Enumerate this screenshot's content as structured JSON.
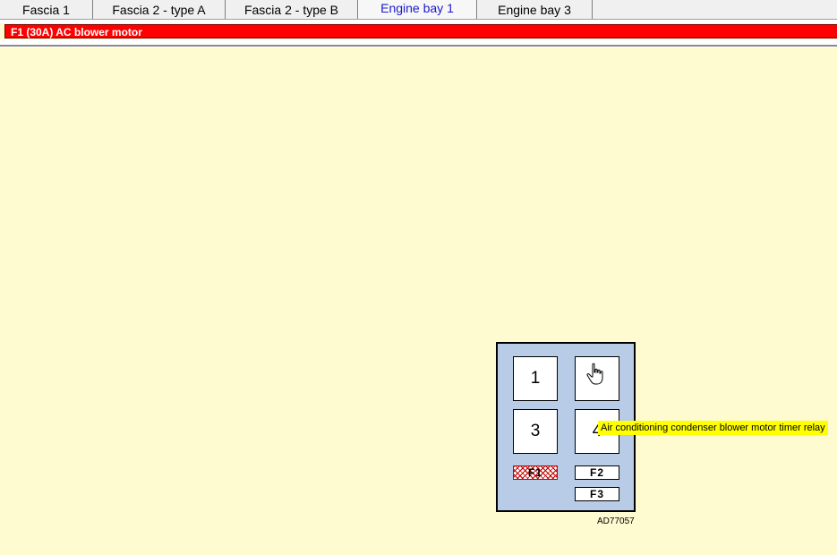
{
  "tabs": [
    {
      "label": "Fascia 1"
    },
    {
      "label": "Fascia 2 - type A"
    },
    {
      "label": "Fascia 2 - type B"
    },
    {
      "label": "Engine bay 1",
      "active": true
    },
    {
      "label": "Engine bay 3"
    }
  ],
  "header": {
    "selected_fuse": "F1 (30A)  AC blower motor"
  },
  "diagram": {
    "relays": [
      {
        "label": "1"
      },
      {
        "label": ""
      },
      {
        "label": "3"
      },
      {
        "label": "4"
      }
    ],
    "fuses": [
      {
        "label": "F1",
        "highlighted": true
      },
      {
        "label": "F2"
      },
      {
        "label": "F3"
      }
    ],
    "tooltip": "Air conditioning condenser blower motor timer relay",
    "reference_code": "AD77057"
  },
  "colors": {
    "background": "#fffbd0",
    "header_bar": "#ff0000",
    "fuse_box": "#b8cce8",
    "tooltip": "#ffff00",
    "active_tab_text": "#1a1acc",
    "highlight_hatch": "#c00000"
  },
  "icons": {
    "cursor": "hand-pointer-icon"
  }
}
